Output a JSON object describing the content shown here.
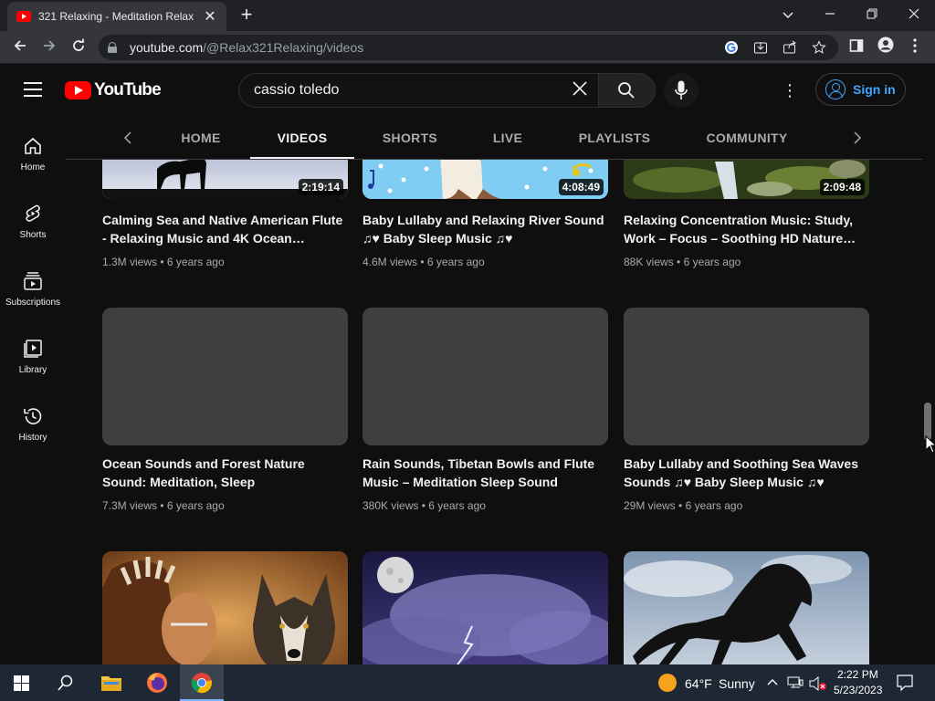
{
  "browser": {
    "tab_title": "321 Relaxing - Meditation Relax",
    "tab_close": "✕",
    "new_tab": "+",
    "url_host": "youtube.com",
    "url_path": "/@Relax321Relaxing/videos"
  },
  "youtube": {
    "logo_text": "YouTube",
    "search_query": "cassio toledo",
    "more": "⋮",
    "sign_in": "Sign in"
  },
  "guide": {
    "items": [
      {
        "label": "Home",
        "icon": "home-icon"
      },
      {
        "label": "Shorts",
        "icon": "shorts-icon"
      },
      {
        "label": "Subscriptions",
        "icon": "subscriptions-icon"
      },
      {
        "label": "Library",
        "icon": "library-icon"
      },
      {
        "label": "History",
        "icon": "history-icon"
      }
    ]
  },
  "channel_tabs": {
    "items": [
      "HOME",
      "VIDEOS",
      "SHORTS",
      "LIVE",
      "PLAYLISTS",
      "COMMUNITY"
    ],
    "active": "VIDEOS"
  },
  "videos": {
    "row1": [
      {
        "duration": "2:19:14",
        "title": "Calming Sea and Native American Flute - Relaxing Music and 4K Ocean…",
        "views": "1.3M views",
        "age": "6 years ago"
      },
      {
        "duration": "4:08:49",
        "title": "Baby Lullaby and Relaxing River Sound ♫♥ Baby Sleep Music ♫♥",
        "views": "4.6M views",
        "age": "6 years ago"
      },
      {
        "duration": "2:09:48",
        "title": "Relaxing Concentration Music: Study, Work – Focus – Soothing HD Nature…",
        "views": "88K views",
        "age": "6 years ago"
      }
    ],
    "row2": [
      {
        "title": "Ocean Sounds and Forest Nature Sound: Meditation, Sleep",
        "views": "7.3M views",
        "age": "6 years ago"
      },
      {
        "title": "Rain Sounds, Tibetan Bowls and Flute Music – Meditation Sleep Sound",
        "views": "380K views",
        "age": "6 years ago"
      },
      {
        "title": "Baby Lullaby and Soothing Sea Waves Sounds ♫♥ Baby Sleep Music ♫♥",
        "views": "29M views",
        "age": "6 years ago"
      }
    ]
  },
  "taskbar": {
    "weather_temp": "64°F",
    "weather_text": "Sunny",
    "time": "2:22 PM",
    "date": "5/23/2023"
  },
  "colors": {
    "yt_red": "#ff0000",
    "link_blue": "#3ea6ff",
    "bg": "#0f0f0f"
  }
}
